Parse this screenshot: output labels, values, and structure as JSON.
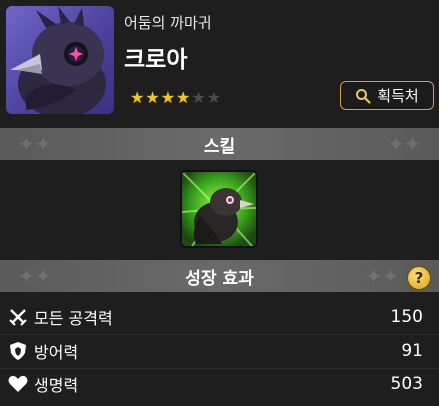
{
  "character": {
    "subtitle": "어둠의 까마귀",
    "name": "크로아",
    "stars_total": 6,
    "stars_filled": 4
  },
  "acquire_button": {
    "label": "획득처",
    "icon": "search-icon"
  },
  "skill_section": {
    "title": "스킬",
    "skill_icon": "crow-skill-icon"
  },
  "growth_section": {
    "title": "성장 효과",
    "help_icon": "question-icon"
  },
  "stats": [
    {
      "icon": "crossed-swords-icon",
      "label": "모든 공격력",
      "value": "150"
    },
    {
      "icon": "shield-icon",
      "label": "방어력",
      "value": "91"
    },
    {
      "icon": "heart-icon",
      "label": "생명력",
      "value": "503"
    }
  ],
  "colors": {
    "star_on": "#f5c518",
    "star_off": "#4a4a4a",
    "button_border": "#c9a640",
    "header_bg": "#5f5f5f",
    "background": "#1e1e1e"
  }
}
